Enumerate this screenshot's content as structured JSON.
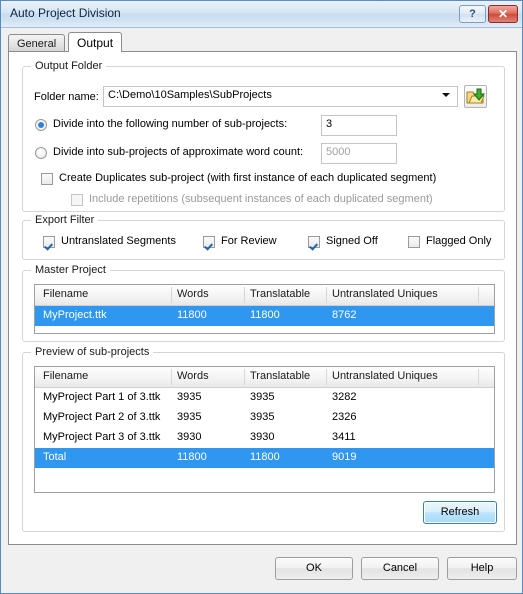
{
  "window": {
    "title": "Auto Project Division",
    "help_button": "?",
    "close_button": "✕"
  },
  "tabs": [
    {
      "label": "General",
      "active": false
    },
    {
      "label": "Output",
      "active": true
    }
  ],
  "output_folder": {
    "legend": "Output Folder",
    "folder_name_label": "Folder name:",
    "folder_name_value": "C:\\Demo\\10Samples\\SubProjects",
    "browse_icon": "folder-open-down-icon",
    "divide_count_label": "Divide into the following number of sub-projects:",
    "divide_count_value": "3",
    "divide_count_selected": true,
    "divide_words_label": "Divide into sub-projects of approximate word count:",
    "divide_words_value": "5000",
    "divide_words_selected": false,
    "duplicates_label": "Create Duplicates sub-project (with first instance of each duplicated segment)",
    "duplicates_checked": false,
    "repetitions_label": "Include repetitions (subsequent instances of each duplicated segment)",
    "repetitions_checked": false,
    "repetitions_disabled": true
  },
  "export_filter": {
    "legend": "Export Filter",
    "items": [
      {
        "label": "Untranslated Segments",
        "checked": true
      },
      {
        "label": "For Review",
        "checked": true
      },
      {
        "label": "Signed Off",
        "checked": true
      },
      {
        "label": "Flagged Only",
        "checked": false
      }
    ]
  },
  "master_project": {
    "legend": "Master Project",
    "columns": [
      "Filename",
      "Words",
      "Translatable",
      "Untranslated Uniques"
    ],
    "rows": [
      {
        "cells": [
          "MyProject.ttk",
          "11800",
          "11800",
          "8762"
        ],
        "selected": true
      }
    ]
  },
  "preview_subprojects": {
    "legend": "Preview of sub-projects",
    "columns": [
      "Filename",
      "Words",
      "Translatable",
      "Untranslated Uniques"
    ],
    "rows": [
      {
        "cells": [
          "MyProject Part 1 of 3.ttk",
          "3935",
          "3935",
          "3282"
        ],
        "selected": false
      },
      {
        "cells": [
          "MyProject Part 2 of 3.ttk",
          "3935",
          "3935",
          "2326"
        ],
        "selected": false
      },
      {
        "cells": [
          "MyProject Part 3 of 3.ttk",
          "3930",
          "3930",
          "3411"
        ],
        "selected": false
      },
      {
        "cells": [
          "Total",
          "11800",
          "11800",
          "9019"
        ],
        "selected": true
      }
    ],
    "refresh_label": "Refresh"
  },
  "dialog_buttons": {
    "ok": "OK",
    "cancel": "Cancel",
    "help": "Help"
  },
  "colors": {
    "selection_blue": "#2f97f0",
    "title_bar_blue": "#cfe2f3",
    "close_red": "#cf4a39",
    "focus_border": "#3c7fb1"
  }
}
